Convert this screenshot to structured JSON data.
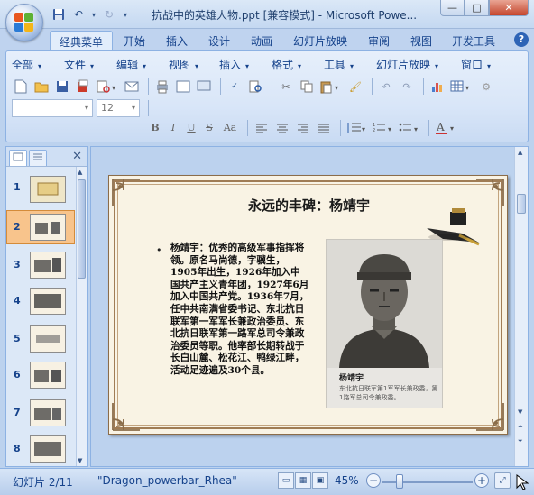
{
  "window": {
    "title": "抗战中的英雄人物.ppt [兼容模式] - Microsoft Powe...",
    "minimize": "—",
    "maximize": "□",
    "close": "✕"
  },
  "ribbon_tabs": [
    "经典菜单",
    "开始",
    "插入",
    "设计",
    "动画",
    "幻灯片放映",
    "审阅",
    "视图",
    "开发工具"
  ],
  "help": "?",
  "classic_menu": [
    "全部",
    "文件",
    "编辑",
    "视图",
    "插入",
    "格式",
    "工具",
    "幻灯片放映",
    "窗口"
  ],
  "font": {
    "name": "",
    "size": "12"
  },
  "format_buttons": [
    "B",
    "I",
    "U",
    "S",
    "Aa"
  ],
  "left_pane": {
    "close": "✕",
    "slide_numbers": [
      "1",
      "2",
      "3",
      "4",
      "5",
      "6",
      "7",
      "8"
    ],
    "selected": 2
  },
  "slide": {
    "title": "永远的丰碑：杨靖宇",
    "bullet": "•",
    "body": "杨靖宇：优秀的高级军事指挥将领。原名马尚德，字骥生，1905年出生，1926年加入中国共产主义青年团，1927年6月加入中国共产党。1936年7月，任中共南满省委书记、东北抗日联军第一军军长兼政治委员、东北抗日联军第一路军总司令兼政治委员等职。他率部长期转战于长白山麓、松花江、鸭绿江畔，活动足迹遍及30个县。",
    "photo_caption": "杨靖宇",
    "photo_subcaption": "东北抗日联军第1军军长兼政委，第1路军总司令兼政委。"
  },
  "status": {
    "slide_info": "幻灯片 2/11",
    "theme": "\"Dragon_powerbar_Rhea\"",
    "zoom": "45%",
    "zoom_value": 45
  },
  "colors": {
    "accent": "#15428b",
    "ribbon": "#d9e6f8",
    "selection": "#f8c48c",
    "slide_bg": "#f9f3e4"
  }
}
